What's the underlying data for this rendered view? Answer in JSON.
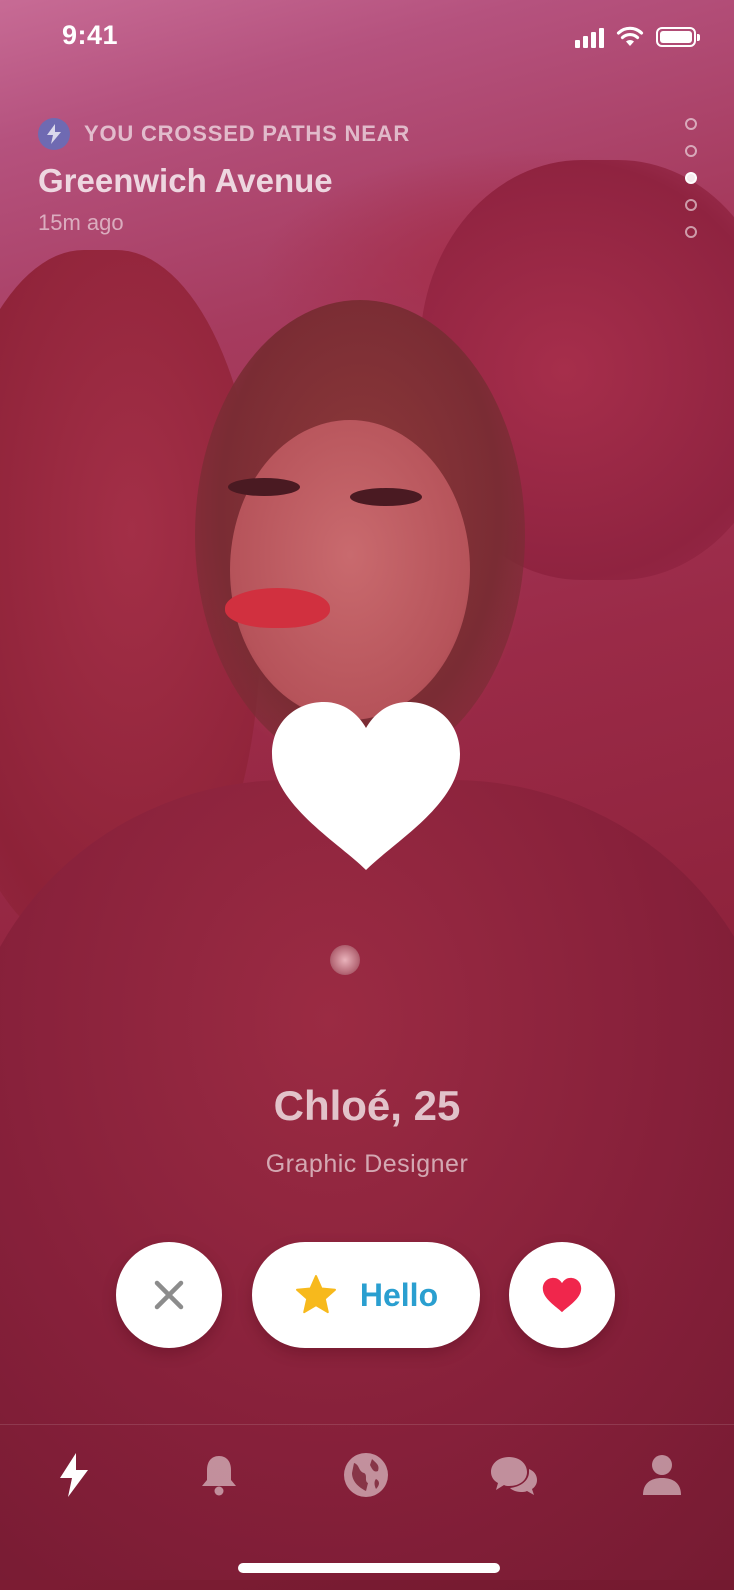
{
  "status_bar": {
    "time": "9:41"
  },
  "crossed_paths": {
    "caption": "YOU CROSSED PATHS NEAR",
    "place": "Greenwich Avenue",
    "time_ago": "15m ago",
    "icon": "lightning-icon"
  },
  "photo_pager": {
    "total": 5,
    "active_index": 2
  },
  "overlay": {
    "icon": "heart-icon"
  },
  "profile": {
    "name_age": "Chloé, 25",
    "occupation": "Graphic Designer"
  },
  "actions": {
    "nope_icon": "close-icon",
    "hello_icon": "star-icon",
    "hello_label": "Hello",
    "like_icon": "heart-icon"
  },
  "tab_bar": {
    "items": [
      {
        "icon": "lightning-icon",
        "active": true
      },
      {
        "icon": "bell-icon",
        "active": false
      },
      {
        "icon": "globe-icon",
        "active": false
      },
      {
        "icon": "chat-bubbles-icon",
        "active": false
      },
      {
        "icon": "profile-icon",
        "active": false
      }
    ]
  },
  "colors": {
    "overlay_tint": "#9a2a47",
    "hello_text": "#2a9fd0",
    "like_heart": "#f0264c",
    "star": "#f7b91c",
    "badge": "#6f6ab2"
  }
}
